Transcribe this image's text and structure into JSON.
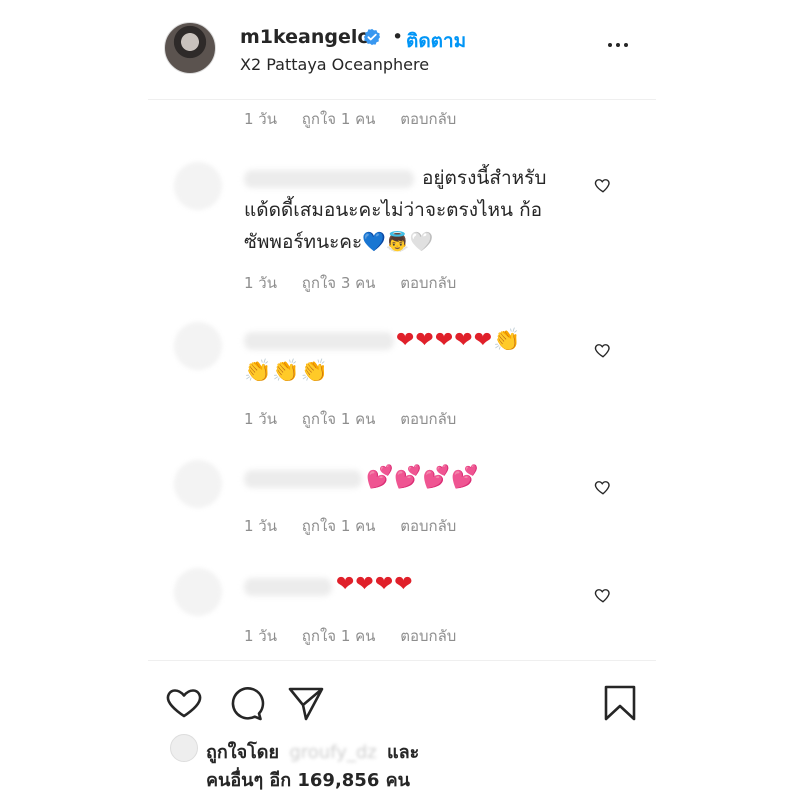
{
  "header": {
    "username": "m1keangelo",
    "verified_icon": "verified-badge-icon",
    "separator": "•",
    "follow_label": "ติดตาม",
    "location": "X2 Pattaya Oceanphere",
    "more_icon": "more-options-icon"
  },
  "comments": [
    {
      "time": "1 วัน",
      "likes": "ถูกใจ 1 คน",
      "reply": "ตอบกลับ"
    },
    {
      "text_line1": "อยู่ตรงนี้สำหรับ",
      "text_line2": "แด้ดดี้เสมอนะคะไม่ว่าจะตรงไหน ก้อ",
      "text_line3": "ซัพพอร์ทนะคะ",
      "emojis": "💙👼🤍",
      "time": "1 วัน",
      "likes": "ถูกใจ 3 คน",
      "reply": "ตอบกลับ"
    },
    {
      "emoji_line1": "❤❤❤❤❤👏",
      "emoji_line2": "👏👏👏",
      "time": "1 วัน",
      "likes": "ถูกใจ 1 คน",
      "reply": "ตอบกลับ"
    },
    {
      "emoji_line1": "💕💕💕💕",
      "time": "1 วัน",
      "likes": "ถูกใจ 1 คน",
      "reply": "ตอบกลับ"
    },
    {
      "emoji_line1": "❤❤❤❤",
      "time": "1 วัน",
      "likes": "ถูกใจ 1 คน",
      "reply": "ตอบกลับ"
    }
  ],
  "actions": {
    "like_icon": "heart-icon",
    "comment_icon": "comment-icon",
    "share_icon": "share-icon",
    "save_icon": "bookmark-icon"
  },
  "likes": {
    "prefix": "ถูกใจโดย",
    "liker": "groufy_dz",
    "conj": "และ",
    "others": "คนอื่นๆ อีก 169,856 คน"
  },
  "colors": {
    "accent": "#0095f6",
    "heart_red": "#e0202a",
    "meta_gray": "#8e8e8e"
  }
}
